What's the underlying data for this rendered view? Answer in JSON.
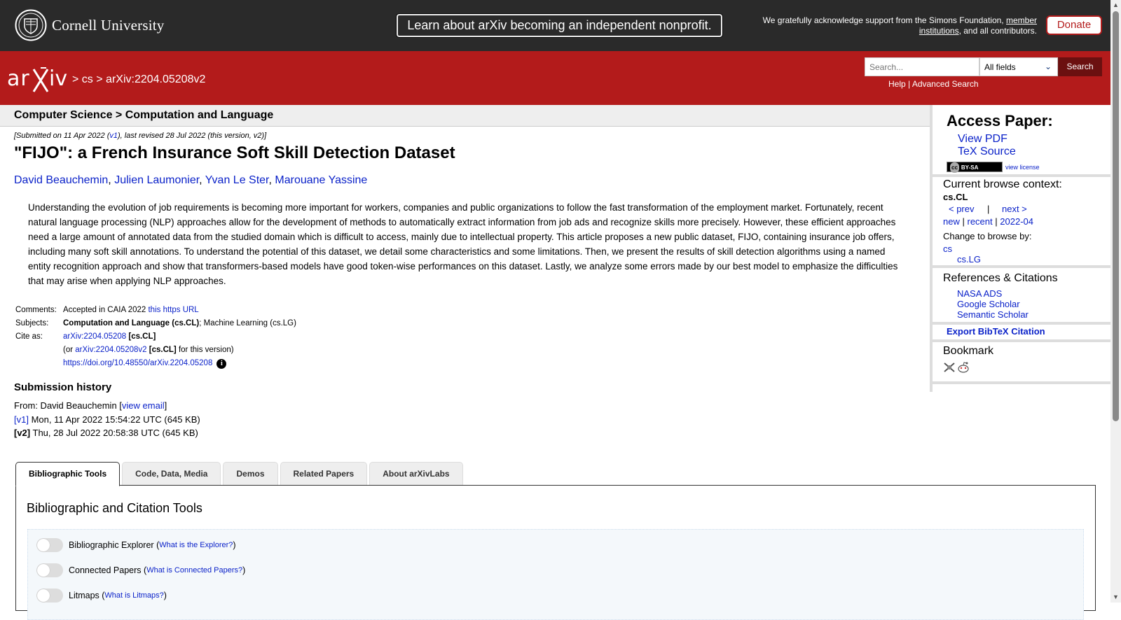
{
  "cornell": {
    "name": "Cornell University",
    "announcement": "Learn about arXiv becoming an independent nonprofit.",
    "ack_prefix": "We gratefully acknowledge support from the Simons Foundation,",
    "ack_link": "member institutions",
    "ack_suffix": ", and all contributors.",
    "donate": "Donate"
  },
  "header": {
    "breadcrumb_sep1": ">",
    "breadcrumb_cs": "cs",
    "breadcrumb_sep2": ">",
    "breadcrumb_id": "arXiv:2204.05208v2",
    "search_placeholder": "Search...",
    "search_field": "All fields",
    "search_button": "Search",
    "help": "Help",
    "link_sep": "|",
    "advanced": "Advanced Search"
  },
  "paper": {
    "subheader": "Computer Science > Computation and Language",
    "submitted_prefix": "[Submitted on 11 Apr 2022 (",
    "submitted_v1": "v1",
    "submitted_suffix": "), last revised 28 Jul 2022 (this version, v2)]",
    "title": "\"FIJO\": a French Insurance Soft Skill Detection Dataset",
    "authors": [
      "David Beauchemin",
      "Julien Laumonier",
      "Yvan Le Ster",
      "Marouane Yassine"
    ],
    "abstract": "Understanding the evolution of job requirements is becoming more important for workers, companies and public organizations to follow the fast transformation of the employment market. Fortunately, recent natural language processing (NLP) approaches allow for the development of methods to automatically extract information from job ads and recognize skills more precisely. However, these efficient approaches need a large amount of annotated data from the studied domain which is difficult to access, mainly due to intellectual property. This article proposes a new public dataset, FIJO, containing insurance job offers, including many soft skill annotations. To understand the potential of this dataset, we detail some characteristics and some limitations. Then, we present the results of skill detection algorithms using a named entity recognition approach and show that transformers-based models have good token-wise performances on this dataset. Lastly, we analyze some errors made by our best model to emphasize the difficulties that may arise when applying NLP approaches.",
    "comments_label": "Comments:",
    "comments_text": "Accepted in CAIA 2022",
    "comments_link": "this https URL",
    "subjects_label": "Subjects:",
    "subjects_primary": "Computation and Language (cs.CL)",
    "subjects_rest": "; Machine Learning (cs.LG)",
    "cite_label": "Cite as:",
    "cite_id": "arXiv:2204.05208",
    "cite_cat": "[cs.CL]",
    "cite_or": "(or",
    "cite_version_id": "arXiv:2204.05208v2",
    "cite_version_cat": "[cs.CL]",
    "cite_version_suffix": "for this version)",
    "doi": "https://doi.org/10.48550/arXiv.2204.05208",
    "info_glyph": "i"
  },
  "history": {
    "heading": "Submission history",
    "from_label": "From: David Beauchemin",
    "view_email": "view email",
    "v1_label": "[v1]",
    "v1_text": "Mon, 11 Apr 2022 15:54:22 UTC (645 KB)",
    "v2_label": "[v2]",
    "v2_text": "Thu, 28 Jul 2022 20:58:38 UTC (645 KB)"
  },
  "tabs": [
    "Bibliographic Tools",
    "Code, Data, Media",
    "Demos",
    "Related Papers",
    "About arXivLabs"
  ],
  "tools": {
    "title": "Bibliographic and Citation Tools",
    "rows": [
      {
        "label": "Bibliographic Explorer",
        "help": "What is the Explorer?"
      },
      {
        "label": "Connected Papers",
        "help": "What is Connected Papers?"
      },
      {
        "label": "Litmaps",
        "help": "What is Litmaps?"
      }
    ]
  },
  "sidebar": {
    "access_heading": "Access Paper:",
    "view_pdf": "View PDF",
    "tex_source": "TeX Source",
    "license_badge": "BY-SA",
    "license_cc": "cc",
    "view_license": "view license",
    "browse_heading": "Current browse context:",
    "browse_context": "cs.CL",
    "prev": "< prev",
    "browse_sep": "|",
    "next": "next >",
    "new": "new",
    "recent": "recent",
    "month": "2022-04",
    "change_browse": "Change to browse by:",
    "browse_cs": "cs",
    "browse_lg": "cs.LG",
    "refs_heading": "References & Citations",
    "nasa": "NASA ADS",
    "google": "Google Scholar",
    "semantic": "Semantic Scholar",
    "bibtex": "Export BibTeX Citation",
    "bookmark_heading": "Bookmark"
  },
  "colors": {
    "arxiv_red": "#b31b1b",
    "cornell_dark": "#2a2a2a",
    "link_blue": "#0b22c9"
  }
}
